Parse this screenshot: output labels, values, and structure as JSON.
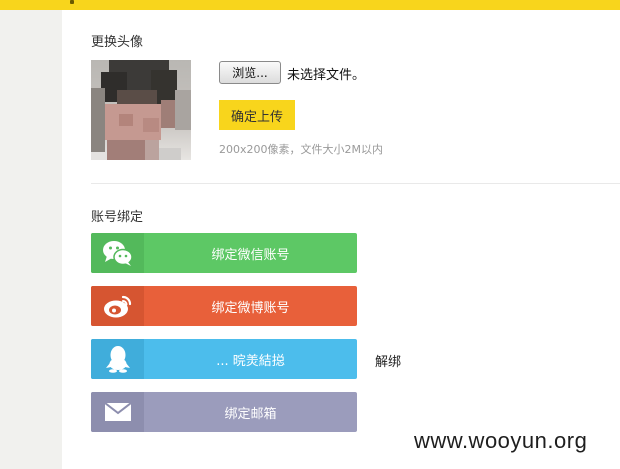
{
  "avatar_section": {
    "title": "更换头像",
    "browse_label": "浏览...",
    "file_status": "未选择文件。",
    "upload_label": "确定上传",
    "hint": "200x200像素，文件大小2M以内"
  },
  "binding_section": {
    "title": "账号绑定",
    "buttons": [
      {
        "label": "绑定微信账号",
        "icon": "wechat-icon",
        "color": "#5dc865",
        "icon_bg": "#53b95b"
      },
      {
        "label": "绑定微博账号",
        "icon": "weibo-icon",
        "color": "#e8603a",
        "icon_bg": "#d65531"
      },
      {
        "label": "... 晥羙結搃",
        "icon": "qq-icon",
        "color": "#4cbdec",
        "icon_bg": "#40addb"
      },
      {
        "label": "绑定邮箱",
        "icon": "mail-icon",
        "color": "#9b9cbc",
        "icon_bg": "#8d8eae"
      }
    ],
    "unbind_label": "解绑"
  },
  "watermark": "www.wooyun.org",
  "colors": {
    "accent": "#f8d51c"
  }
}
